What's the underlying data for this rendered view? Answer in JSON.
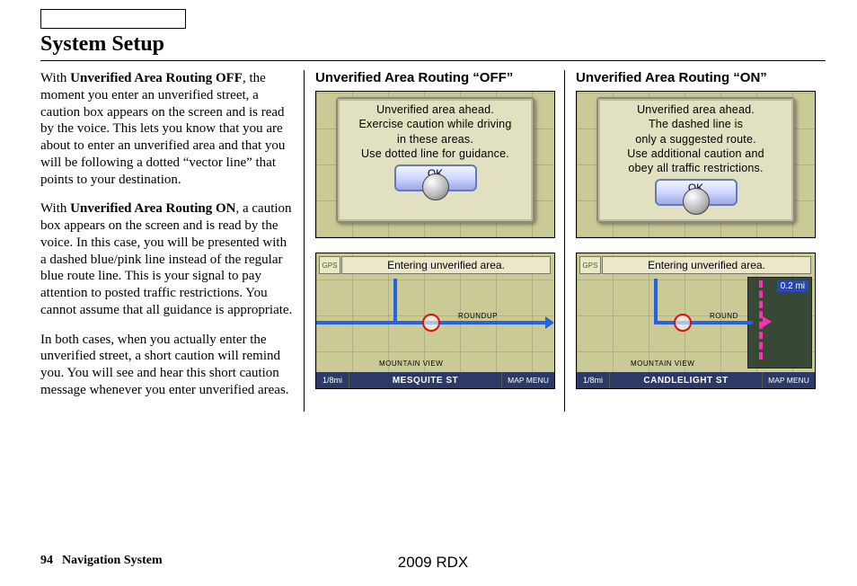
{
  "page": {
    "title": "System Setup",
    "number": "94",
    "section": "Navigation System",
    "model": "2009 RDX"
  },
  "left": {
    "p1_lead": "With ",
    "p1_bold": "Unverified Area Routing OFF",
    "p1_rest": ", the moment you enter an unverified street, a caution box appears on the screen and is read by the voice. This lets you know that you are about to enter an unverified area and that you will be following a dotted “vector line” that points to your destination.",
    "p2_lead": "With ",
    "p2_bold": "Unverified Area Routing ON",
    "p2_rest": ", a caution box appears on the screen and is read by the voice. In this case, you will be presented with a dashed blue/pink line instead of the regular blue route line. This is your signal to pay attention to posted traffic restrictions. You cannot assume that all guidance is appropriate.",
    "p3": "In both cases, when you actually enter the unverified street, a short caution will remind you. You will see and hear this short caution message whenever you enter unverified areas."
  },
  "off": {
    "heading": "Unverified Area Routing “OFF”",
    "dialog": {
      "l1": "Unverified area ahead.",
      "l2": "Exercise caution while driving",
      "l3": "in these areas.",
      "l4": "Use dotted line for guidance.",
      "ok": "OK"
    },
    "banner": "Entering unverified area.",
    "gps": "GPS",
    "scale": "1/8mi",
    "street": "MESQUITE ST",
    "menu": "MAP MENU",
    "label_roundup": "ROUNDUP",
    "label_mv": "MOUNTAIN VIEW"
  },
  "on": {
    "heading": "Unverified Area Routing “ON”",
    "dialog": {
      "l1": "Unverified area ahead.",
      "l2": "The dashed line is",
      "l3": "only a suggested route.",
      "l4": "Use additional caution and",
      "l5": "obey all traffic restrictions.",
      "ok": "OK"
    },
    "banner": "Entering unverified area.",
    "gps": "GPS",
    "scale": "1/8mi",
    "street": "CANDLELIGHT ST",
    "menu": "MAP MENU",
    "dist": "0.2 mi",
    "label_round": "ROUND",
    "label_mv": "MOUNTAIN VIEW"
  }
}
